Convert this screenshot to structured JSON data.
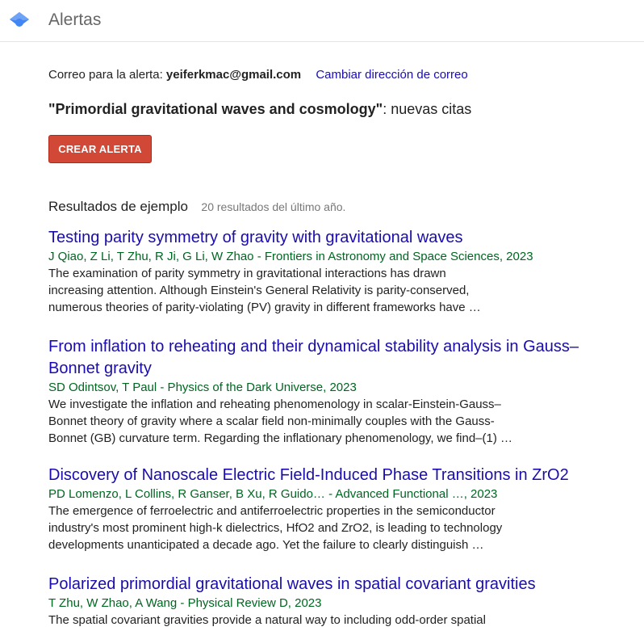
{
  "header": {
    "title": "Alertas",
    "logo_icon": "scholar-logo-icon",
    "logo_color": "#4285f4"
  },
  "alert": {
    "email_label": "Correo para la alerta:",
    "email": "yeiferkmac@gmail.com",
    "change_email_link": "Cambiar dirección de correo",
    "query_quoted": "\"Primordial gravitational waves and cosmology\"",
    "query_suffix": ": nuevas citas",
    "create_button": "CREAR ALERTA"
  },
  "results": {
    "heading": "Resultados de ejemplo",
    "count": "20 resultados del último año.",
    "items": [
      {
        "title_lines": [
          "Testing parity symmetry of gravity with gravitational waves"
        ],
        "authors": "J Qiao, Z Li, T Zhu, R Ji, G Li, W Zhao - Frontiers in Astronomy and Space Sciences, 2023",
        "snippet_lines": [
          "The examination of parity symmetry in gravitational interactions has drawn",
          "increasing attention. Although Einstein's General Relativity is parity-conserved,",
          "numerous theories of parity-violating (PV) gravity in different frameworks have …"
        ]
      },
      {
        "title_lines": [
          "From inflation to reheating and their dynamical stability analysis in Gauss–",
          "Bonnet gravity"
        ],
        "authors": "SD Odintsov, T Paul - Physics of the Dark Universe, 2023",
        "snippet_lines": [
          "We investigate the inflation and reheating phenomenology in scalar-Einstein-Gauss–",
          "Bonnet theory of gravity where a scalar field non-minimally couples with the Gauss-",
          "Bonnet (GB) curvature term. Regarding the inflationary phenomenology, we find–(1) …"
        ]
      },
      {
        "title_lines": [
          "Discovery of Nanoscale Electric Field-Induced Phase Transitions in ZrO2"
        ],
        "authors": "PD Lomenzo, L Collins, R Ganser, B Xu, R Guido… - Advanced Functional …, 2023",
        "snippet_lines": [
          "The emergence of ferroelectric and antiferroelectric properties in the semiconductor",
          "industry's most prominent high-k dielectrics, HfO2 and ZrO2, is leading to technology",
          "developments unanticipated a decade ago. Yet the failure to clearly distinguish …"
        ]
      },
      {
        "title_lines": [
          "Polarized primordial gravitational waves in spatial covariant gravities"
        ],
        "authors": "T Zhu, W Zhao, A Wang - Physical Review D, 2023",
        "snippet_lines": [
          "The spatial covariant gravities provide a natural way to including odd-order spatial"
        ]
      }
    ]
  }
}
